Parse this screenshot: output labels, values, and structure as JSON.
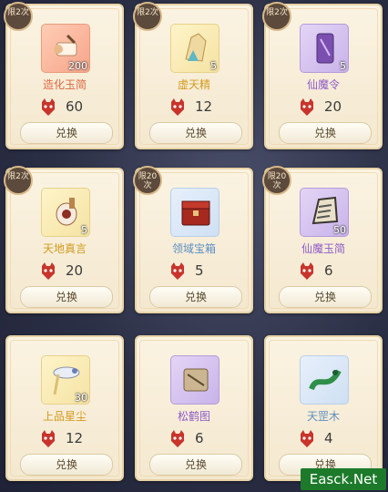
{
  "button_label": "兑换",
  "watermark": "Easck.Net",
  "items": [
    {
      "name": "造化玉简",
      "count": "200",
      "price": "60",
      "badge": "限2次",
      "rarity": "orange",
      "icon": "scroll-icon"
    },
    {
      "name": "虚天精",
      "count": "5",
      "price": "12",
      "badge": "限2次",
      "rarity": "yellow",
      "icon": "crystal-icon"
    },
    {
      "name": "仙魔令",
      "count": "5",
      "price": "20",
      "badge": "限2次",
      "rarity": "purple",
      "icon": "token-icon"
    },
    {
      "name": "天地真言",
      "count": "5",
      "price": "20",
      "badge": "限2次",
      "rarity": "yellow",
      "icon": "bundle-icon"
    },
    {
      "name": "领域宝箱",
      "count": "",
      "price": "5",
      "badge": "限20次",
      "rarity": "blue",
      "icon": "chest-icon"
    },
    {
      "name": "仙魔玉简",
      "count": "50",
      "price": "6",
      "badge": "限20次",
      "rarity": "purple",
      "icon": "jade-scroll-icon"
    },
    {
      "name": "上品星尘",
      "count": "30",
      "price": "12",
      "badge": "",
      "rarity": "yellow",
      "icon": "stardust-icon"
    },
    {
      "name": "松鹤图",
      "count": "",
      "price": "6",
      "badge": "",
      "rarity": "purple",
      "icon": "painting-icon"
    },
    {
      "name": "天罡木",
      "count": "",
      "price": "4",
      "badge": "",
      "rarity": "blue",
      "icon": "dragon-wood-icon"
    }
  ],
  "colors": {
    "orange": "#e0663f",
    "yellow": "#d49a1c",
    "purple": "#8f5bc9",
    "blue": "#5d8fc3"
  }
}
